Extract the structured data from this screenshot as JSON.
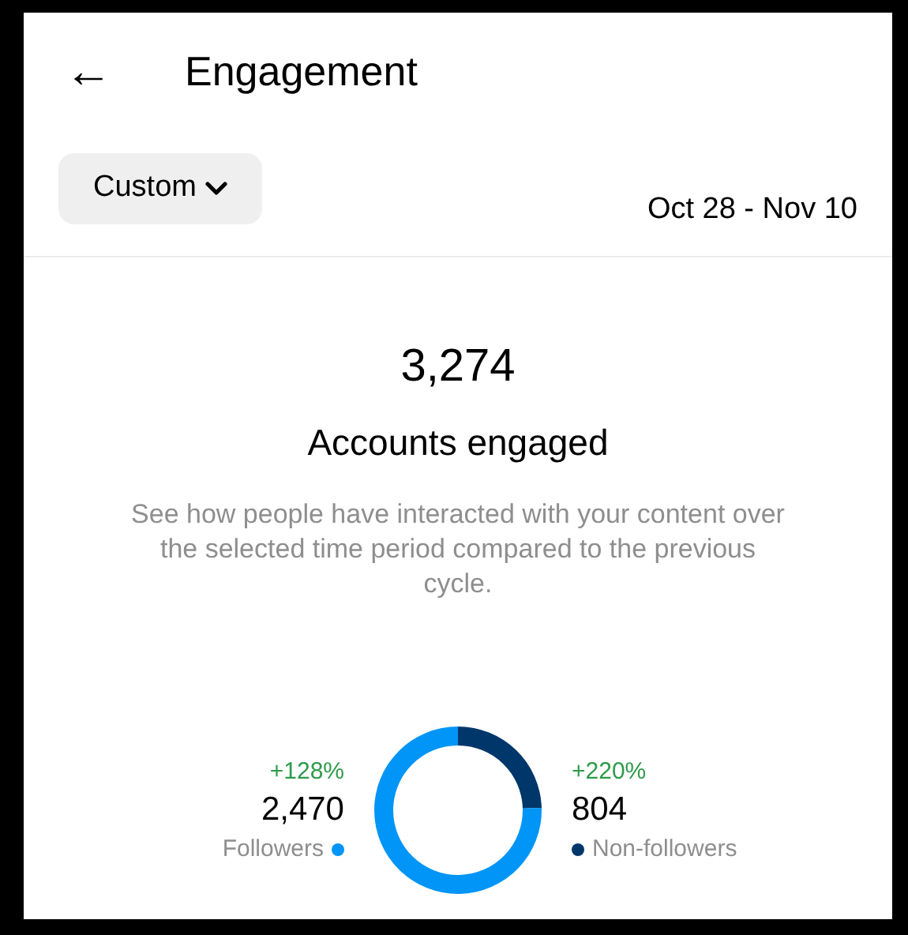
{
  "header": {
    "back": "←",
    "title": "Engagement"
  },
  "filter": {
    "label": "Custom",
    "date_range": "Oct 28 - Nov 10"
  },
  "summary": {
    "value": "3,274",
    "title": "Accounts engaged",
    "description": "See how people have interacted with your content over the selected time period compared to the previous cycle."
  },
  "breakdown": {
    "chart_data": {
      "type": "donut",
      "categories": [
        "Followers",
        "Non-followers"
      ],
      "values": [
        75.44,
        24.56
      ]
    },
    "groups": [
      {
        "change": "+128%",
        "count": "2,470",
        "color": "#0095f6"
      },
      {
        "change": "+220%",
        "count": "804",
        "color": "#00376b"
      }
    ]
  }
}
